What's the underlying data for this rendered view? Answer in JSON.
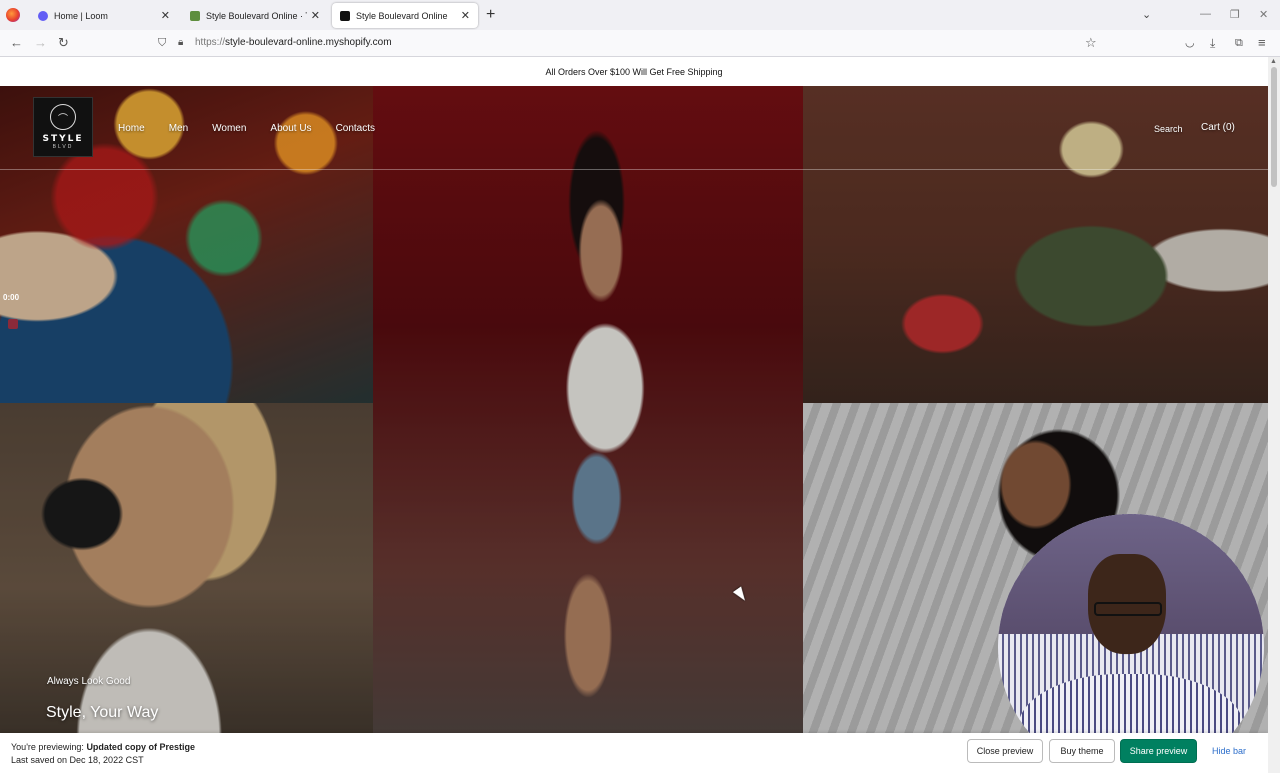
{
  "browser": {
    "tabs": [
      {
        "title": "Home | Loom",
        "favicon_color": "#625df5"
      },
      {
        "title": "Style Boulevard Online · Theme",
        "favicon_color": "#5e8e3e"
      },
      {
        "title": "Style Boulevard Online",
        "favicon_color": "#111111"
      }
    ],
    "url_scheme": "https://",
    "url_host": "style-boulevard-online.myshopify.com"
  },
  "announcement": "All Orders Over $100 Will Get Free Shipping",
  "logo": {
    "word": "STYLE",
    "sub": "BLVD"
  },
  "nav": [
    "Home",
    "Men",
    "Women",
    "About Us",
    "Contacts"
  ],
  "header": {
    "search": "Search",
    "cart": "Cart (0)"
  },
  "hero": {
    "kicker": "Always Look Good",
    "title": "Style, Your Way"
  },
  "loom": {
    "timer": "0:00"
  },
  "preview_bar": {
    "previewing_prefix": "You're previewing: ",
    "theme_name": "Updated copy of Prestige",
    "last_saved": "Last saved on Dec 18, 2022 CST",
    "close": "Close preview",
    "buy": "Buy theme",
    "share": "Share preview",
    "hide": "Hide bar"
  },
  "colors": {
    "share_button": "#008060",
    "hide_link": "#2c6ecb"
  }
}
